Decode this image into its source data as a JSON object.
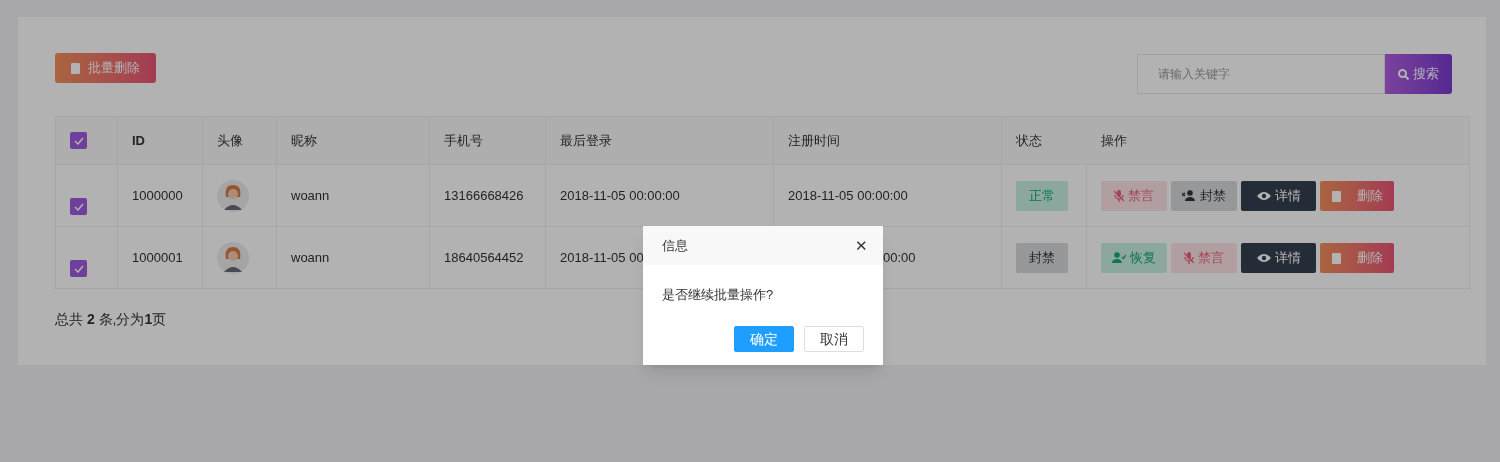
{
  "toolbar": {
    "batch_delete": "批量删除",
    "search": {
      "placeholder": "请输入关键字",
      "button": "搜索"
    }
  },
  "table": {
    "header_checked": true,
    "columns": [
      "ID",
      "头像",
      "昵称",
      "手机号",
      "最后登录",
      "注册时间",
      "状态",
      "操作"
    ],
    "rows": [
      {
        "checked": true,
        "id": "1000000",
        "nickname": "woann",
        "phone": "13166668426",
        "last_login": "2018-11-05 00:00:00",
        "register_time": "2018-11-05 00:00:00",
        "register_cut": false,
        "status": {
          "kind": "normal",
          "label": "正常"
        },
        "actions": [
          {
            "kind": "mute",
            "label": "禁言"
          },
          {
            "kind": "ban",
            "label": "封禁"
          },
          {
            "kind": "detail",
            "label": "详情"
          },
          {
            "kind": "delete",
            "label": "删除"
          }
        ]
      },
      {
        "checked": true,
        "id": "1000001",
        "nickname": "woann",
        "phone": "18640564452",
        "last_login": "2018-11-05 00",
        "register_time": "00:00",
        "register_cut": true,
        "status": {
          "kind": "banned",
          "label": "封禁"
        },
        "actions": [
          {
            "kind": "restore",
            "label": "恢复"
          },
          {
            "kind": "mute",
            "label": "禁言"
          },
          {
            "kind": "detail",
            "label": "详情"
          },
          {
            "kind": "delete",
            "label": "删除"
          }
        ]
      }
    ]
  },
  "summary": "总共 **2** 条,分为**1**页",
  "dialog": {
    "title": "信息",
    "close": "✕",
    "message": "是否继续批量操作?",
    "buttons": [
      {
        "kind": "primary",
        "label": "确定"
      },
      {
        "kind": "secondary",
        "label": "取消"
      }
    ]
  }
}
